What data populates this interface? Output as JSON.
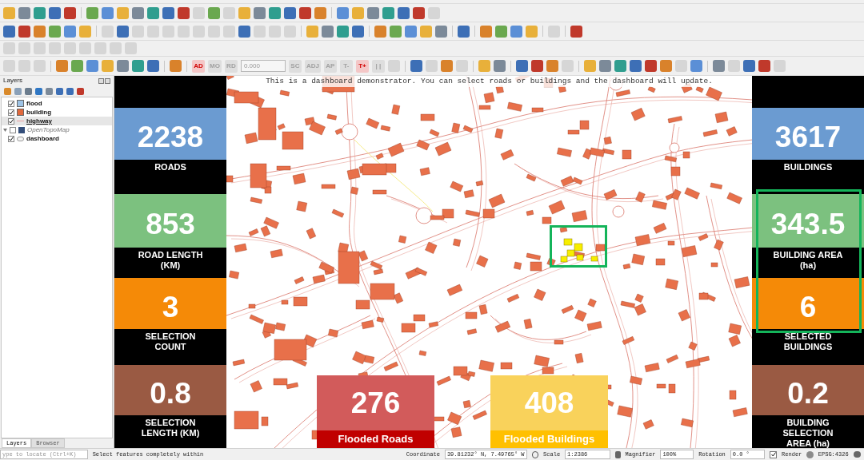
{
  "toolbars": [
    {
      "items": [
        {
          "kind": "icon",
          "disabled": false
        },
        {
          "kind": "icon",
          "disabled": false
        },
        {
          "kind": "icon",
          "disabled": false
        },
        {
          "kind": "icon",
          "disabled": false
        },
        {
          "kind": "icon",
          "disabled": false
        },
        {
          "kind": "sep"
        },
        {
          "kind": "icon",
          "disabled": false
        },
        {
          "kind": "icon",
          "disabled": false
        },
        {
          "kind": "icon",
          "disabled": false
        },
        {
          "kind": "icon",
          "disabled": false
        },
        {
          "kind": "icon",
          "disabled": false
        },
        {
          "kind": "icon",
          "disabled": false
        },
        {
          "kind": "icon",
          "disabled": false
        },
        {
          "kind": "icon",
          "disabled": true
        },
        {
          "kind": "icon",
          "disabled": false
        },
        {
          "kind": "icon",
          "disabled": true
        },
        {
          "kind": "icon",
          "disabled": false
        },
        {
          "kind": "icon",
          "disabled": false
        },
        {
          "kind": "icon",
          "disabled": false
        },
        {
          "kind": "icon",
          "disabled": false
        },
        {
          "kind": "icon",
          "disabled": false
        },
        {
          "kind": "icon",
          "disabled": false
        },
        {
          "kind": "sep"
        },
        {
          "kind": "icon",
          "disabled": false
        },
        {
          "kind": "icon",
          "disabled": false
        },
        {
          "kind": "icon",
          "disabled": false
        },
        {
          "kind": "icon",
          "disabled": false
        },
        {
          "kind": "icon",
          "disabled": false
        },
        {
          "kind": "icon",
          "disabled": false
        },
        {
          "kind": "icon",
          "disabled": true
        }
      ]
    },
    {
      "items": [
        {
          "kind": "icon",
          "disabled": false
        },
        {
          "kind": "icon",
          "disabled": false
        },
        {
          "kind": "icon",
          "disabled": false
        },
        {
          "kind": "icon",
          "disabled": false
        },
        {
          "kind": "icon",
          "disabled": false
        },
        {
          "kind": "icon",
          "disabled": false
        },
        {
          "kind": "sep"
        },
        {
          "kind": "icon",
          "disabled": true
        },
        {
          "kind": "icon",
          "disabled": false
        },
        {
          "kind": "icon",
          "disabled": true
        },
        {
          "kind": "icon",
          "disabled": true
        },
        {
          "kind": "icon",
          "disabled": true
        },
        {
          "kind": "icon",
          "disabled": true
        },
        {
          "kind": "icon",
          "disabled": true
        },
        {
          "kind": "icon",
          "disabled": true
        },
        {
          "kind": "icon",
          "disabled": true
        },
        {
          "kind": "icon",
          "disabled": false
        },
        {
          "kind": "icon",
          "disabled": true
        },
        {
          "kind": "icon",
          "disabled": true
        },
        {
          "kind": "icon",
          "disabled": true
        },
        {
          "kind": "sep"
        },
        {
          "kind": "icon",
          "disabled": false
        },
        {
          "kind": "icon",
          "disabled": false
        },
        {
          "kind": "icon",
          "disabled": false
        },
        {
          "kind": "icon",
          "disabled": false
        },
        {
          "kind": "sep"
        },
        {
          "kind": "icon",
          "disabled": false
        },
        {
          "kind": "icon",
          "disabled": false
        },
        {
          "kind": "icon",
          "disabled": false
        },
        {
          "kind": "icon",
          "disabled": false
        },
        {
          "kind": "icon",
          "disabled": false
        },
        {
          "kind": "sep"
        },
        {
          "kind": "icon",
          "disabled": false
        },
        {
          "kind": "sep"
        },
        {
          "kind": "icon",
          "disabled": false
        },
        {
          "kind": "icon",
          "disabled": false
        },
        {
          "kind": "icon",
          "disabled": false
        },
        {
          "kind": "icon",
          "disabled": false
        },
        {
          "kind": "sep"
        },
        {
          "kind": "icon",
          "disabled": true
        },
        {
          "kind": "sep"
        },
        {
          "kind": "icon",
          "disabled": false
        }
      ]
    },
    {
      "items": [
        {
          "kind": "icon",
          "disabled": true
        },
        {
          "kind": "icon",
          "disabled": true
        },
        {
          "kind": "icon",
          "disabled": true
        },
        {
          "kind": "icon",
          "disabled": true
        },
        {
          "kind": "icon",
          "disabled": true
        },
        {
          "kind": "icon",
          "disabled": true
        },
        {
          "kind": "icon",
          "disabled": true
        },
        {
          "kind": "icon",
          "disabled": true
        },
        {
          "kind": "icon",
          "disabled": true
        }
      ]
    },
    {
      "items": [
        {
          "kind": "icon",
          "disabled": true
        },
        {
          "kind": "icon",
          "disabled": true
        },
        {
          "kind": "icon",
          "disabled": true
        },
        {
          "kind": "sep"
        },
        {
          "kind": "icon",
          "disabled": false
        },
        {
          "kind": "icon",
          "disabled": false
        },
        {
          "kind": "icon",
          "disabled": false
        },
        {
          "kind": "icon",
          "disabled": false
        },
        {
          "kind": "icon",
          "disabled": false
        },
        {
          "kind": "icon",
          "disabled": false
        },
        {
          "kind": "icon",
          "disabled": false
        },
        {
          "kind": "sep"
        },
        {
          "kind": "icon",
          "disabled": false
        },
        {
          "kind": "sep"
        },
        {
          "kind": "label",
          "text": "AD",
          "disabled": false
        },
        {
          "kind": "label",
          "text": "MO",
          "disabled": true
        },
        {
          "kind": "label",
          "text": "RD",
          "disabled": true
        },
        {
          "kind": "spin",
          "value": "0.000"
        },
        {
          "kind": "label",
          "text": "SC",
          "disabled": true
        },
        {
          "kind": "label",
          "text": "ADJ",
          "disabled": true
        },
        {
          "kind": "label",
          "text": "AP",
          "disabled": true
        },
        {
          "kind": "label",
          "text": "T-",
          "disabled": true
        },
        {
          "kind": "label",
          "text": "T+",
          "disabled": false
        },
        {
          "kind": "label",
          "text": "| |",
          "disabled": true
        },
        {
          "kind": "icon",
          "disabled": true
        },
        {
          "kind": "sep"
        },
        {
          "kind": "icon",
          "disabled": false
        },
        {
          "kind": "icon",
          "disabled": true
        },
        {
          "kind": "icon",
          "disabled": false
        },
        {
          "kind": "icon",
          "disabled": true
        },
        {
          "kind": "sep"
        },
        {
          "kind": "icon",
          "disabled": false
        },
        {
          "kind": "icon",
          "disabled": false
        },
        {
          "kind": "sep"
        },
        {
          "kind": "icon",
          "disabled": false
        },
        {
          "kind": "icon",
          "disabled": false
        },
        {
          "kind": "icon",
          "disabled": false
        },
        {
          "kind": "icon",
          "disabled": true
        },
        {
          "kind": "sep"
        },
        {
          "kind": "icon",
          "disabled": false
        },
        {
          "kind": "icon",
          "disabled": false
        },
        {
          "kind": "icon",
          "disabled": false
        },
        {
          "kind": "icon",
          "disabled": false
        },
        {
          "kind": "icon",
          "disabled": false
        },
        {
          "kind": "icon",
          "disabled": false
        },
        {
          "kind": "icon",
          "disabled": true
        },
        {
          "kind": "icon",
          "disabled": false
        },
        {
          "kind": "sep"
        },
        {
          "kind": "icon",
          "disabled": false
        },
        {
          "kind": "icon",
          "disabled": true
        },
        {
          "kind": "icon",
          "disabled": false
        },
        {
          "kind": "icon",
          "disabled": false
        },
        {
          "kind": "icon",
          "disabled": true
        }
      ]
    }
  ],
  "layers_panel": {
    "title": "Layers",
    "layers": [
      {
        "name": "flood",
        "kind": "fill",
        "color": "#9dc3e6",
        "checked": true,
        "selected": false
      },
      {
        "name": "building",
        "kind": "fill",
        "color": "#e0683c",
        "checked": true,
        "selected": false
      },
      {
        "name": "highway",
        "kind": "line",
        "color": "#e8a0a0",
        "checked": true,
        "selected": true
      },
      {
        "name": "OpenTopoMap",
        "kind": "raster",
        "checked": false,
        "selected": false
      },
      {
        "name": "dashboard",
        "kind": "annotation",
        "checked": true,
        "selected": false
      }
    ],
    "tabs": [
      {
        "label": "Layers",
        "selected": true
      },
      {
        "label": "Browser",
        "selected": false
      }
    ]
  },
  "dashboard": {
    "note": "This is a dashboard demonstrator. You can select roads or buildings and the dashboard will update.",
    "left": [
      {
        "value": "2238",
        "label": "ROADS",
        "color": "#6b9bd1"
      },
      {
        "value": "853",
        "label": "ROAD LENGTH (KM)",
        "color": "#7cc17f"
      },
      {
        "value": "3",
        "label": "SELECTION COUNT",
        "color": "#f58a07"
      },
      {
        "value": "0.8",
        "label": "SELECTION LENGTH (KM)",
        "color": "#9a5a43"
      }
    ],
    "right": [
      {
        "value": "3617",
        "label": "BUILDINGS",
        "color": "#6b9bd1"
      },
      {
        "value": "343.5",
        "label": "BUILDING AREA (ha)",
        "color": "#7cc17f"
      },
      {
        "value": "6",
        "label": "SELECTED BUILDINGS",
        "color": "#f58a07"
      },
      {
        "value": "0.2",
        "label": "BUILDING SELECTION AREA (ha)",
        "color": "#9a5a43"
      }
    ],
    "bottom": [
      {
        "value": "276",
        "label": "Flooded Roads",
        "color": "#c00000"
      },
      {
        "value": "408",
        "label": "Flooded Buildings",
        "color": "#ffc000"
      }
    ]
  },
  "status_bar": {
    "locator_placeholder": "ype to locate (Ctrl+K)",
    "message": "Select features completely within",
    "coordinate_label": "Coordinate",
    "coordinate": "39.81232° N, 7.49765° W",
    "scale_label": "Scale",
    "scale": "1:2386",
    "magnifier_label": "Magnifier",
    "magnifier": "100%",
    "rotation_label": "Rotation",
    "rotation": "0.0 °",
    "render_label": "Render",
    "render_checked": true,
    "crs": "EPSG:4326"
  }
}
